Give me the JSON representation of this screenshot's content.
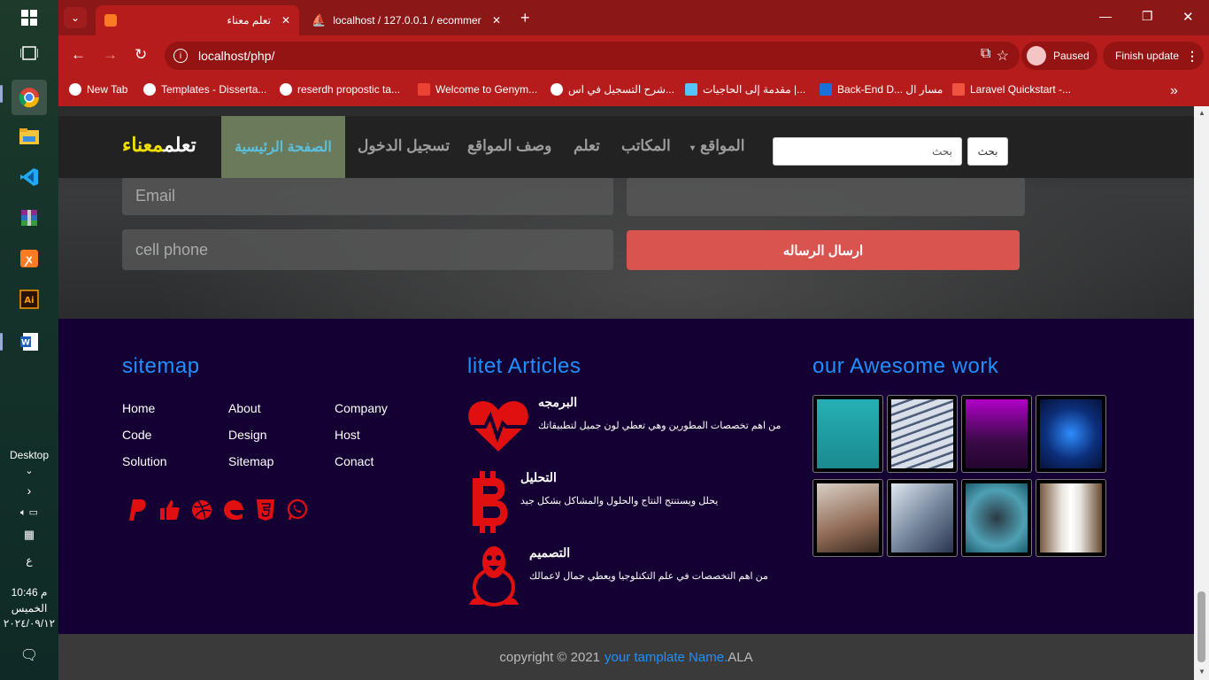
{
  "browser": {
    "tabs": [
      {
        "title": "تعلم معناء"
      },
      {
        "title": "localhost / 127.0.0.1 / ecommer"
      }
    ],
    "url": "localhost/php/",
    "profile_status": "Paused",
    "update_label": "Finish update",
    "bookmarks": [
      {
        "label": "New Tab"
      },
      {
        "label": "Templates - Disserta..."
      },
      {
        "label": "reserdh propostic ta..."
      },
      {
        "label": "Welcome to Genym..."
      },
      {
        "label": "شرح التسجيل في اس..."
      },
      {
        "label": "مقدمة إلى الحاجيات |..."
      },
      {
        "label": "Back-End D... مسار ال"
      },
      {
        "label": "Laravel Quickstart -..."
      }
    ]
  },
  "taskbar": {
    "desktop_label": "Desktop",
    "lang": "ع",
    "time": "10:46 م",
    "day": "الخميس",
    "date": "٢٠٢٤/٠٩/١٢"
  },
  "nav": {
    "brand_main": "تعلم",
    "brand_accent": "معناء",
    "items": [
      "الصفحة الرئيسية",
      "تسجيل الدخول",
      "وصف المواقع",
      "تعلم",
      "المكاتب",
      "المواقع"
    ],
    "search_placeholder": "بحث",
    "search_button": "بحث"
  },
  "contact_form": {
    "email_placeholder": "Email",
    "phone_placeholder": "cell phone",
    "send_label": "ارسال الرساله"
  },
  "footer": {
    "sitemap_title": "sitemap",
    "links": [
      [
        "Home",
        "About",
        "Company"
      ],
      [
        "Code",
        "Design",
        "Host"
      ],
      [
        "Solution",
        "Sitemap",
        "Conact"
      ]
    ],
    "articles_title": "litet Articles",
    "articles": [
      {
        "title": "البرمجه",
        "text": "من اهم تخصصات المطورين وهي تعطي لون جميل لتطبيقاتك"
      },
      {
        "title": "التحليل",
        "text": "يحلل ويستنتج النتاج والحلول والمشاكل بشكل جيد"
      },
      {
        "title": "التصميم",
        "text": "من اهم التخصصات في علم التكنلوجيا ويعطي جمال لاعمالك"
      }
    ],
    "work_title": "our Awesome work",
    "copyright_prefix": "copyright © 2021",
    "copyright_link": "your tamplate Name.",
    "copyright_suffix": "ALA"
  },
  "colors": {
    "browser_red": "#b61c1c",
    "footer_bg": "#140032",
    "accent_blue": "#1e90ff",
    "icon_red": "#e01010",
    "send_button": "#d9534f",
    "brand_yellow": "#f0e000"
  }
}
